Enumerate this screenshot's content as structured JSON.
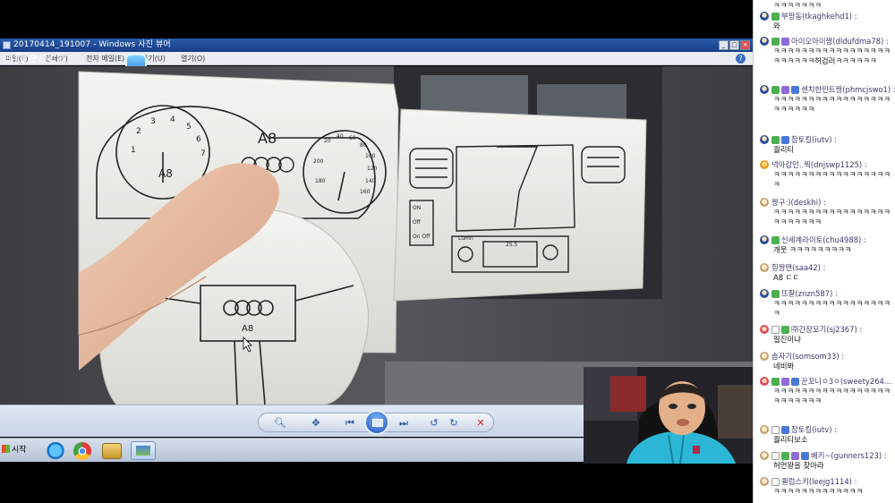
{
  "viewer": {
    "title": "20170414_191007 - Windows 사진 뷰어",
    "window_buttons": [
      "_",
      "□",
      "×"
    ],
    "menu": [
      "파일(F)",
      "인쇄(P)",
      "전자 메일(E)",
      "굽기(U)",
      "열기(O)"
    ],
    "help_label": "?",
    "watermark": "afreeca",
    "photo_labels": {
      "cluster_label": "A8",
      "tach_label": "A8",
      "wheel_label": "A8",
      "console_buttons": [
        "ON",
        "Off",
        "On Off"
      ],
      "speedo_numbers": [
        "20",
        "40",
        "60",
        "80",
        "100",
        "120",
        "140",
        "160",
        "180",
        "200"
      ],
      "tach_numbers": [
        "1",
        "2",
        "3",
        "4",
        "5",
        "6",
        "7"
      ],
      "radio_labels": [
        "Lumn",
        "25.5"
      ]
    },
    "toolbar": {
      "buttons": [
        "zoom",
        "fit",
        "previous",
        "slideshow",
        "next",
        "rotate-ccw",
        "rotate-cw",
        "delete"
      ]
    },
    "taskbar": {
      "start_label": "시작",
      "apps": [
        "internet-explorer",
        "chrome",
        "explorer",
        "photo-viewer"
      ]
    }
  },
  "chat": {
    "top_partial": "ㅋㅋㅋㅋㅋㅋㅋ",
    "messages": [
      {
        "avatar": "blue",
        "badges": [
          "fan"
        ],
        "user": "부팡동(tkaghkehd1) :",
        "text": "와"
      },
      {
        "avatar": "blue",
        "badges": [
          "fan",
          "sub"
        ],
        "user": "아이오아이짱(dldufdma78) :",
        "text": "ㅋㅋㅋㅋㅋㅋㅋㅋㅋㅋㅋㅋㅋㅋㅋㅋㅋㅋㅋㅋㅋㅋㅋ허겁러ㅋㅋㅋㅋㅋㅋ"
      },
      {
        "avatar": "blue",
        "badges": [
          "fan",
          "sub",
          "vip"
        ],
        "user": "센치한민트짱(phmcjswo1) :",
        "text": "ㅋㅋㅋㅋㅋㅋㅋㅋㅋㅋㅋㅋㅋㅋㅋㅋㅋㅋㅋㅋㅋㅋㅋ"
      },
      {
        "avatar": "blue",
        "badges": [
          "fan",
          "vip"
        ],
        "user": "참토킬(iutv) :",
        "text": "퀄리티"
      },
      {
        "avatar": "orange",
        "badges": [],
        "user": "넥아갑인..찍(dnjswp1125) :",
        "text": "ㅋㅋㅋㅋㅋㅋㅋㅋㅋㅋㅋㅋㅋㅋㅋㅋㅋㅋ"
      },
      {
        "avatar": "plain",
        "badges": [],
        "user": "짱구:)(deskhi) :",
        "text": "ㅋㅋㅋㅋㅋㅋㅋㅋㅋㅋㅋㅋㅋㅋㅋㅋㅋㅋㅋㅋㅋㅋㅋㅋ"
      },
      {
        "avatar": "blue",
        "badges": [
          "fan"
        ],
        "user": "신세계라이토(chu4988) :",
        "text": "개웃 ㅋㅋㅋㅋㅋㅋㅋㅋㅋ"
      },
      {
        "avatar": "plain",
        "badges": [],
        "user": "힝짱맨(saa42) :",
        "text": "A8 ㄷㄷ"
      },
      {
        "avatar": "blue",
        "badges": [
          "fan"
        ],
        "user": "뜨잘(znzn587) :",
        "text": "ㅋㅋㅋㅋㅋㅋㅋㅋㅋㅋㅋㅋㅋㅋㅋㅋㅋㅋ"
      },
      {
        "avatar": "heart",
        "badges": [
          "blank",
          "fan"
        ],
        "user": "㈜간장모기(sj2367) :",
        "text": "필진이냐"
      },
      {
        "avatar": "plain",
        "badges": [],
        "user": "솜자기(somsom33) :",
        "text": "네비봐"
      },
      {
        "avatar": "heart",
        "badges": [
          "fan",
          "sub",
          "vip"
        ],
        "user": "꾼꼬니ㅇ3ㅇ(sweety2649) :",
        "text": "ㅋㅋㅋㅋㅋㅋㅋㅋㅋㅋㅋㅋㅋㅋㅋㅋㅋㅋㅋㅋㅋㅋㅋㅋ"
      },
      {
        "avatar": "plain",
        "badges": [
          "blank",
          "vip"
        ],
        "user": "참토킬(iutv) :",
        "text": "퀄리티보소"
      },
      {
        "avatar": "plain",
        "badges": [
          "blank",
          "fan",
          "sub",
          "vip"
        ],
        "user": "베키~(gunners123) :",
        "text": "허언왕을 찾아라"
      },
      {
        "avatar": "plain",
        "badges": [
          "blank"
        ],
        "user": "퀼럽스키(leejg1114) :",
        "text": "ㅋㅋㅋㅋㅋㅋㅋㅋㅋㅋㅋㅋㅋ"
      }
    ]
  },
  "colors": {
    "title_bar": "#1d4b96",
    "chat_user": "#3a3a6a",
    "fan_badge": "#4caf50",
    "sub_badge": "#8e6bd6",
    "vip_badge": "#4a78d6"
  }
}
